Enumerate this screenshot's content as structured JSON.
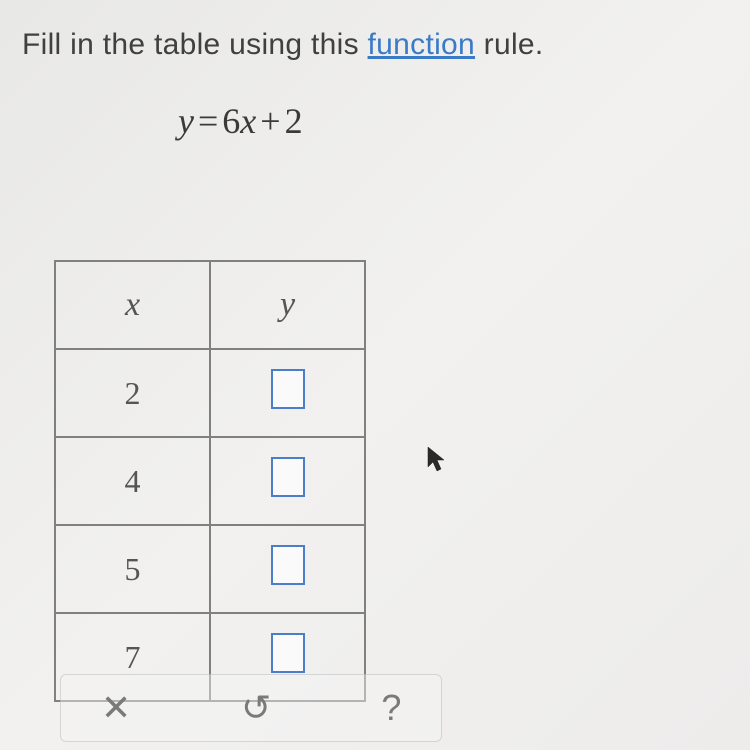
{
  "instruction": {
    "prefix": "Fill in the table using this ",
    "link": "function",
    "suffix": " rule."
  },
  "equation": {
    "lhs": "y",
    "eq": "=",
    "coef": "6",
    "var": "x",
    "op": "+",
    "constant": "2"
  },
  "table": {
    "headers": {
      "x": "x",
      "y": "y"
    },
    "rows": [
      {
        "x": "2",
        "y": ""
      },
      {
        "x": "4",
        "y": ""
      },
      {
        "x": "5",
        "y": ""
      },
      {
        "x": "7",
        "y": ""
      }
    ]
  },
  "toolbar": {
    "clear": "✕",
    "undo": "↺",
    "help": "?"
  },
  "chart_data": {
    "type": "table",
    "title": "Function rule y = 6x + 2",
    "columns": [
      "x",
      "y"
    ],
    "rows": [
      {
        "x": 2,
        "y": null
      },
      {
        "x": 4,
        "y": null
      },
      {
        "x": 5,
        "y": null
      },
      {
        "x": 7,
        "y": null
      }
    ]
  }
}
